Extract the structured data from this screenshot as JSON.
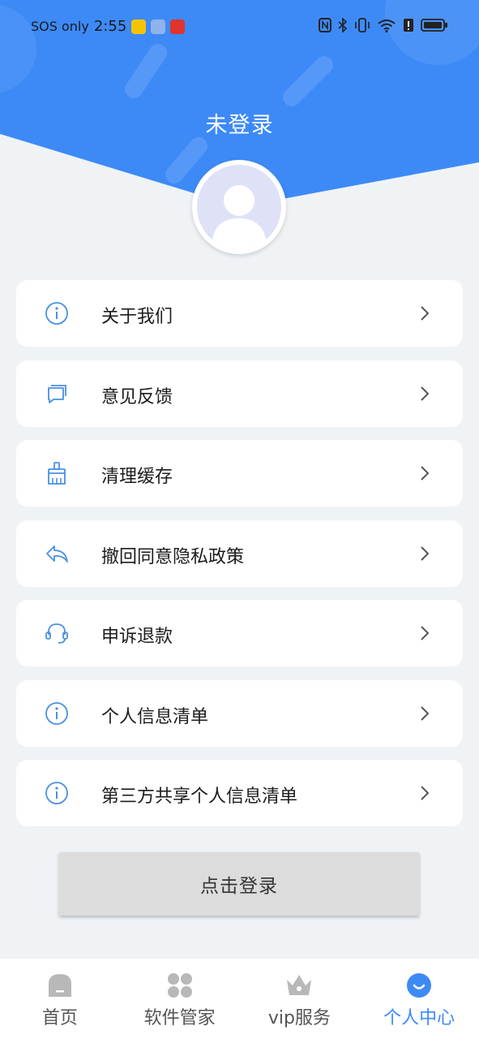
{
  "colors": {
    "accent": "#3d8af7",
    "background": "#eff3f6",
    "icon": "#4a90e2"
  },
  "status_bar": {
    "carrier": "SOS only",
    "time": "2:55"
  },
  "header": {
    "title": "未登录"
  },
  "menu": {
    "items": [
      {
        "label": "关于我们",
        "icon": "info-icon"
      },
      {
        "label": "意见反馈",
        "icon": "feedback-icon"
      },
      {
        "label": "清理缓存",
        "icon": "broom-icon"
      },
      {
        "label": "撤回同意隐私政策",
        "icon": "revoke-icon"
      },
      {
        "label": "申诉退款",
        "icon": "headset-icon"
      },
      {
        "label": "个人信息清单",
        "icon": "info-icon"
      },
      {
        "label": "第三方共享个人信息清单",
        "icon": "info-icon"
      }
    ]
  },
  "login_button": {
    "label": "点击登录"
  },
  "tabbar": {
    "tabs": [
      {
        "label": "首页",
        "icon": "home-icon"
      },
      {
        "label": "软件管家",
        "icon": "apps-icon"
      },
      {
        "label": "vip服务",
        "icon": "crown-icon"
      },
      {
        "label": "个人中心",
        "icon": "profile-icon",
        "active": true
      }
    ]
  }
}
